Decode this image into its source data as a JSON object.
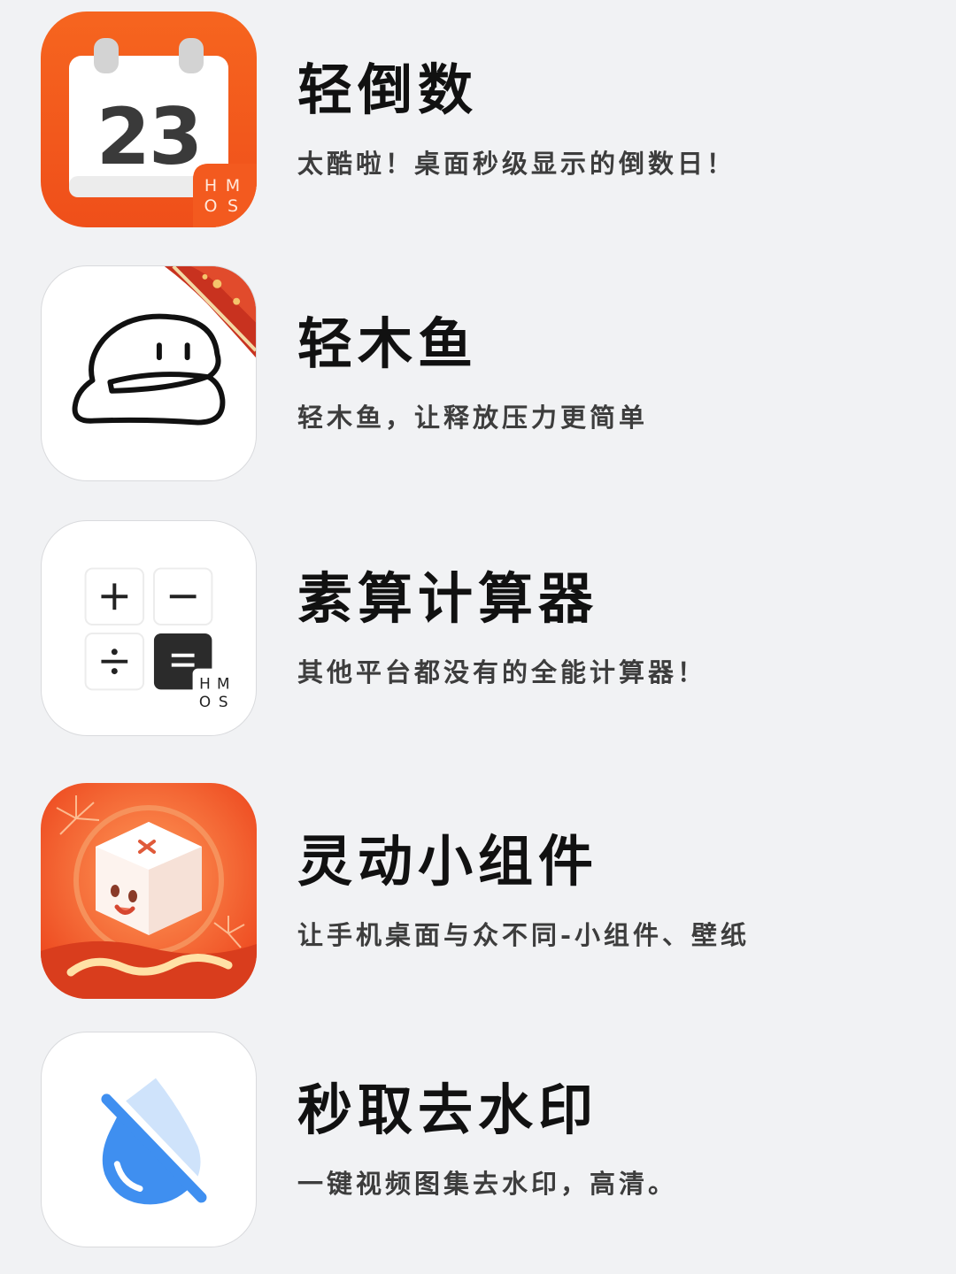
{
  "apps": [
    {
      "name": "轻倒数",
      "description": "太酷啦！桌面秒级显示的倒数日！",
      "icon": "calendar-countdown-icon",
      "icon_number": "23",
      "badge_text": [
        "H",
        "M",
        "O",
        "S"
      ],
      "icon_bg": "#f25a1d"
    },
    {
      "name": "轻木鱼",
      "description": "轻木鱼，让释放压力更简单",
      "icon": "wooden-fish-icon",
      "icon_bg": "#ffffff"
    },
    {
      "name": "素算计算器",
      "description": "其他平台都没有的全能计算器！",
      "icon": "calculator-icon",
      "badge_text": [
        "H",
        "M",
        "O",
        "S"
      ],
      "icon_bg": "#ffffff"
    },
    {
      "name": "灵动小组件",
      "description": "让手机桌面与众不同-小组件、壁纸",
      "icon": "cube-mascot-icon",
      "icon_bg": "#f26a35"
    },
    {
      "name": "秒取去水印",
      "description": "一键视频图集去水印，高清。",
      "icon": "water-drop-slash-icon",
      "icon_bg": "#ffffff"
    }
  ],
  "colors": {
    "background": "#f1f2f4",
    "title": "#111111",
    "description": "#3d3d3d",
    "accent_orange": "#f25a1d",
    "drop_blue": "#3f8ff0"
  }
}
